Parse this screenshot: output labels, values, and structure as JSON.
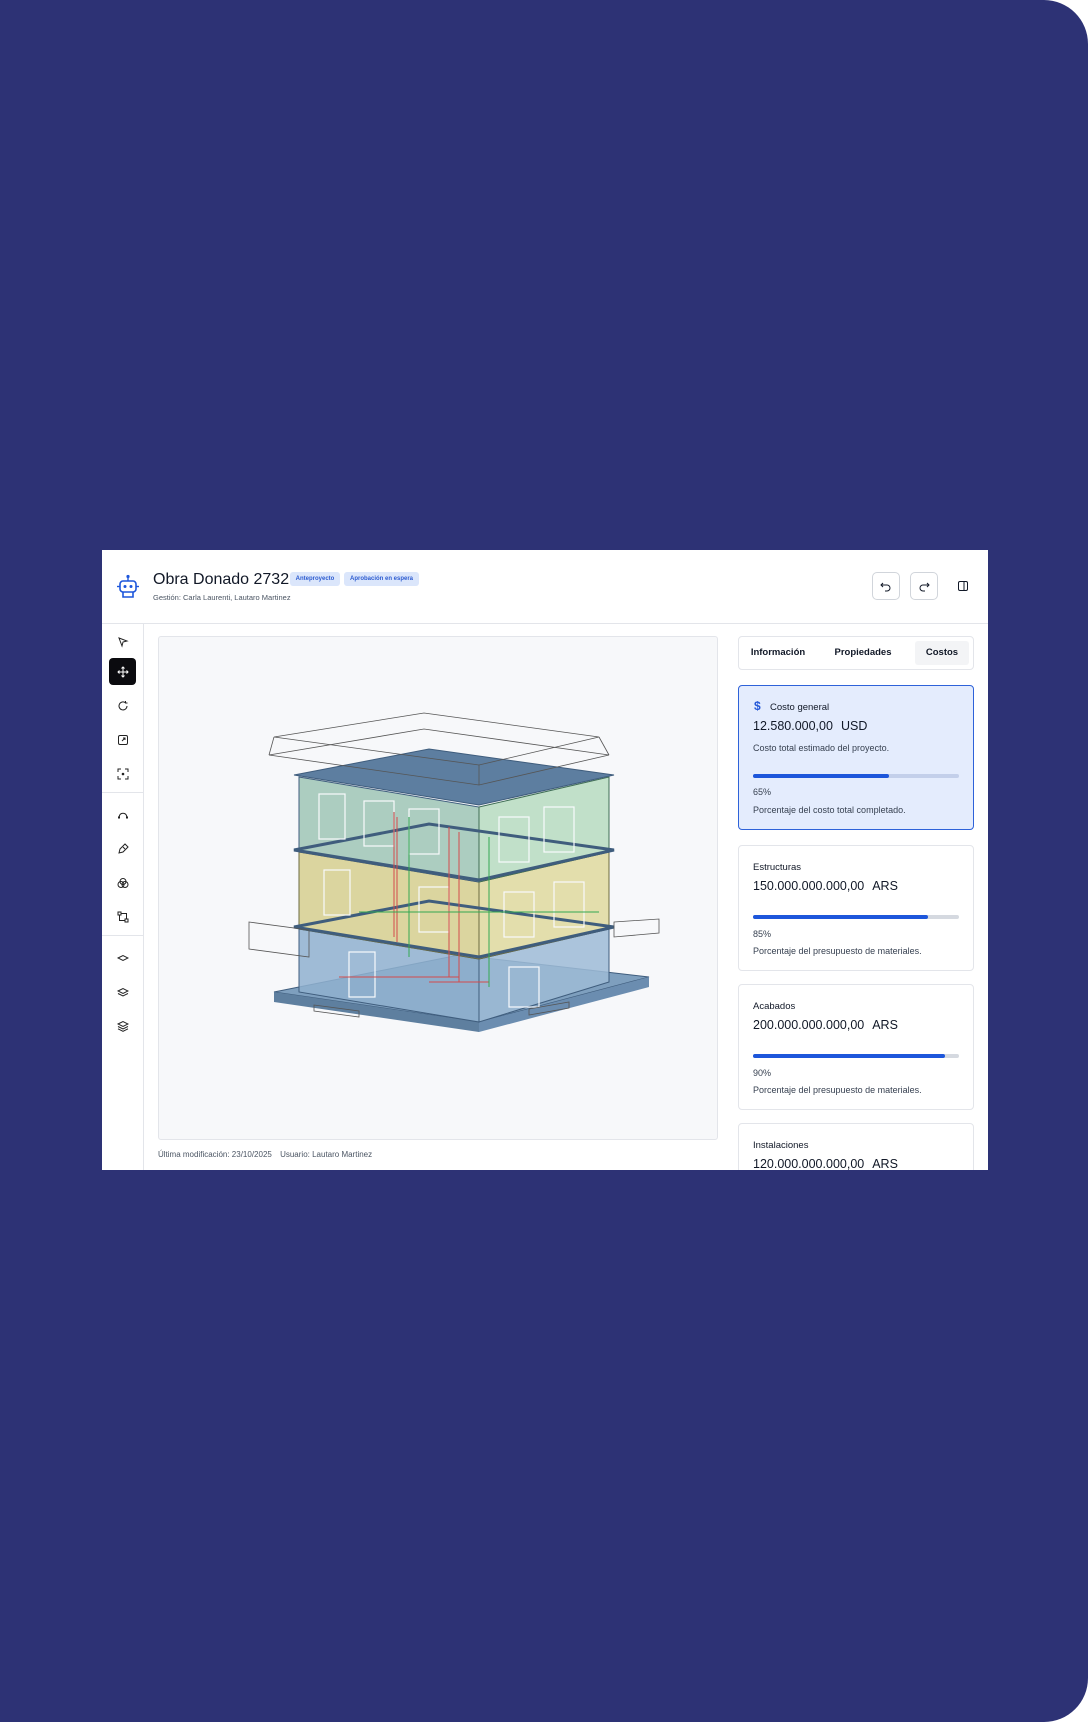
{
  "header": {
    "title": "Obra Donado 2732",
    "badges": [
      "Anteproyecto",
      "Aprobación en espera"
    ],
    "subtitle": "Gestión: Carla Laurenti, Lautaro Martinez"
  },
  "tabs": [
    "Información",
    "Propiedades",
    "Costos"
  ],
  "cost_general": {
    "label": "Costo general",
    "amount": "12.580.000,00",
    "currency": "USD",
    "description": "Costo total estimado del proyecto.",
    "progress": 0.65,
    "percent_label": "65%",
    "percent_description": "Porcentaje del costo total completado."
  },
  "cards": [
    {
      "label": "Estructuras",
      "amount": "150.000.000.000,00",
      "currency": "ARS",
      "progress": 0.85,
      "percent_label": "85%",
      "percent_description": "Porcentaje del presupuesto de materiales."
    },
    {
      "label": "Acabados",
      "amount": "200.000.000.000,00",
      "currency": "ARS",
      "progress": 0.9,
      "percent_label": "90%",
      "percent_description": "Porcentaje del presupuesto de materiales."
    },
    {
      "label": "Instalaciones",
      "amount": "120.000.000.000,00",
      "currency": "ARS"
    }
  ],
  "footer": {
    "modified": "Última modificación: 23/10/2025",
    "user": "Usuario: Lautaro Martinez"
  },
  "toolbar_icons": [
    "select-icon",
    "move-icon",
    "rotate-icon",
    "scale-icon",
    "focus-icon",
    "path-icon",
    "pen-icon",
    "boolean-icon",
    "transform-icon",
    "plane-icon",
    "layer-icon",
    "layers-icon"
  ],
  "colors": {
    "background": "#2d3275",
    "accent": "#1d56db",
    "badge_bg": "#dbe6fb",
    "highlight_card": "#e4ecfd"
  }
}
